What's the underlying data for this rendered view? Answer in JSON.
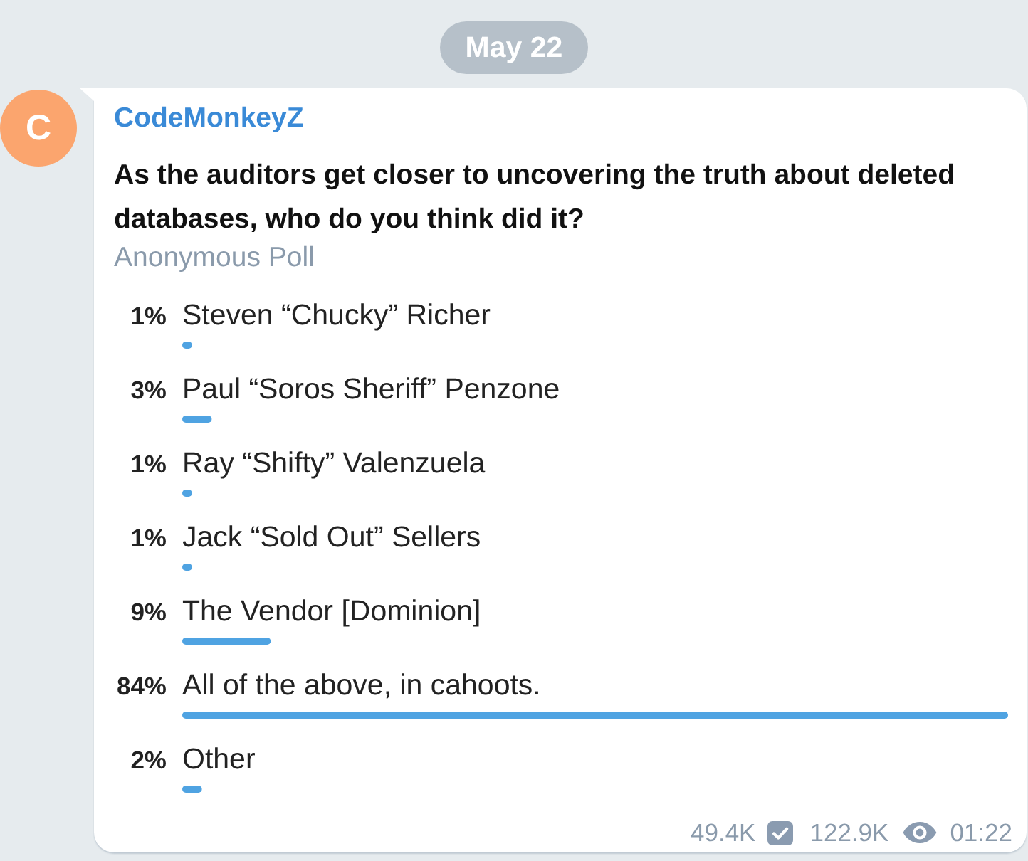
{
  "date_badge": "May 22",
  "message": {
    "avatar": {
      "initial": "C"
    },
    "sender": "CodeMonkeyZ",
    "poll": {
      "question": "As the auditors get closer to uncovering the truth about deleted databases, who do you think did it?",
      "type_label": "Anonymous Poll",
      "chart_data": {
        "type": "bar",
        "orientation": "horizontal",
        "categories": [
          "Steven “Chucky” Richer",
          "Paul “Soros Sheriff” Penzone",
          "Ray “Shifty” Valenzuela",
          "Jack “Sold Out” Sellers",
          "The Vendor [Dominion]",
          "All of the above, in cahoots.",
          "Other"
        ],
        "values": [
          1,
          3,
          1,
          1,
          9,
          84,
          2
        ],
        "value_labels": [
          "1%",
          "3%",
          "1%",
          "1%",
          "9%",
          "84%",
          "2%"
        ]
      }
    },
    "footer": {
      "checked_count": "49.4K",
      "view_count": "122.9K",
      "time": "01:22"
    }
  }
}
